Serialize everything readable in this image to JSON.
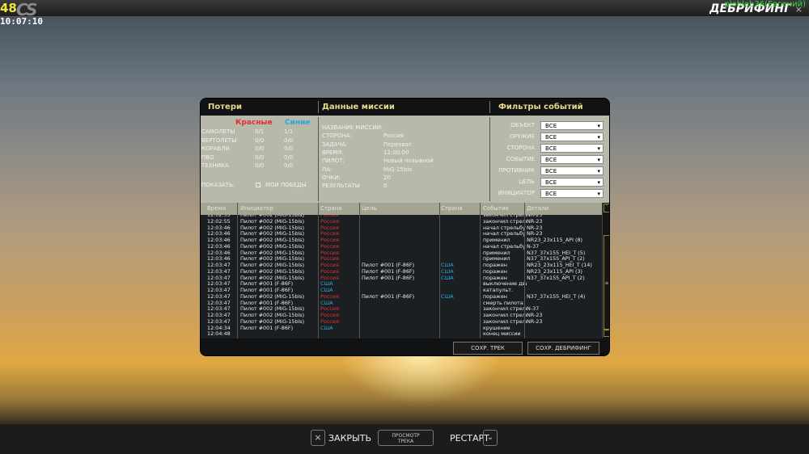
{
  "topbar": {
    "fps": "48",
    "logo": "CS",
    "clock": "10:07:10",
    "title": "ДЕБРИФИНГ",
    "user": "plohleb36(Евгений)",
    "close": "×"
  },
  "losses": {
    "title": "Потери",
    "red": "Красные",
    "blue": "Синие",
    "colors": {
      "red": "#e03030",
      "blue": "#2aa8e0"
    },
    "rows": [
      {
        "label": "САМОЛЕТЫ",
        "red": "0/1",
        "blue": "1/1"
      },
      {
        "label": "ВЕРТОЛЕТЫ",
        "red": "0/0",
        "blue": "0/0"
      },
      {
        "label": "КОРАБЛИ",
        "red": "0/0",
        "blue": "0/0"
      },
      {
        "label": "ПВО",
        "red": "0/0",
        "blue": "0/0"
      },
      {
        "label": "ТЕХНИКА",
        "red": "0/0",
        "blue": "0/0"
      }
    ],
    "show_label": "ПОКАЗАТЬ:",
    "my_wins": "МОИ ПОБЕДЫ",
    "my_wins_checked": false
  },
  "mission": {
    "title": "Данные миссии",
    "rows": [
      {
        "label": "НАЗВАНИЕ МИССИИ:",
        "value": ""
      },
      {
        "label": "СТОРОНА:",
        "value": "Россия"
      },
      {
        "label": "ЗАДАЧА:",
        "value": "Перехват"
      },
      {
        "label": "ВРЕМЯ:",
        "value": "12:00:00"
      },
      {
        "label": "ПИЛОТ:",
        "value": "Новый позывной"
      },
      {
        "label": "ЛА:",
        "value": "MiG-15bis"
      },
      {
        "label": "ОЧКИ:",
        "value": "20"
      },
      {
        "label": "РЕЗУЛЬТАТЫ",
        "value": "0"
      }
    ]
  },
  "filters": {
    "title": "Фильтры событий",
    "items": [
      {
        "label": "ОБЪЕКТ",
        "value": "ВСЕ"
      },
      {
        "label": "ОРУЖИЕ",
        "value": "ВСЕ"
      },
      {
        "label": "СТОРОНА",
        "value": "ВСЕ"
      },
      {
        "label": "СОБЫТИЕ",
        "value": "ВСЕ"
      },
      {
        "label": "ПРОТИВНИК",
        "value": "ВСЕ"
      },
      {
        "label": "ЦЕЛЬ",
        "value": "ВСЕ"
      },
      {
        "label": "ИНИЦИАТОР",
        "value": "ВСЕ"
      }
    ]
  },
  "table": {
    "columns": [
      "Время",
      "Инициатор",
      "Страна",
      "Цель",
      "Страна",
      "Событие",
      "Детали"
    ],
    "rows": [
      [
        "12:02:55",
        "Пилот #002 (MiG-15bis)",
        "Россия",
        "",
        "",
        "закончил стрельбу",
        "NR-23"
      ],
      [
        "12:02:55",
        "Пилот #002 (MiG-15bis)",
        "Россия",
        "",
        "",
        "закончил стрельбу",
        "NR-23"
      ],
      [
        "12:03:46",
        "Пилот #002 (MiG-15bis)",
        "Россия",
        "",
        "",
        "начал стрельбу",
        "NR-23"
      ],
      [
        "12:03:46",
        "Пилот #002 (MiG-15bis)",
        "Россия",
        "",
        "",
        "начал стрельбу",
        "NR-23"
      ],
      [
        "12:03:46",
        "Пилот #002 (MiG-15bis)",
        "Россия",
        "",
        "",
        "применил",
        "NR23_23x115_API (8)"
      ],
      [
        "12:03:46",
        "Пилот #002 (MiG-15bis)",
        "Россия",
        "",
        "",
        "начал стрельбу",
        "N-37"
      ],
      [
        "12:03:46",
        "Пилот #002 (MiG-15bis)",
        "Россия",
        "",
        "",
        "применил",
        "N37_37x155_HEI_T (5)"
      ],
      [
        "12:03:46",
        "Пилот #002 (MiG-15bis)",
        "Россия",
        "",
        "",
        "применил",
        "N37_37x155_API_T  (2)"
      ],
      [
        "12:03:47",
        "Пилот #002 (MiG-15bis)",
        "Россия",
        "Пилот #001 (F-86F)",
        "США",
        "поражен",
        "NR23_23x115_HEI_T (14)"
      ],
      [
        "12:03:47",
        "Пилот #002 (MiG-15bis)",
        "Россия",
        "Пилот #001 (F-86F)",
        "США",
        "поражен",
        "NR23_23x115_API (3)"
      ],
      [
        "12:03:47",
        "Пилот #002 (MiG-15bis)",
        "Россия",
        "Пилот #001 (F-86F)",
        "США",
        "поражен",
        "N37_37x155_API_T  (2)"
      ],
      [
        "12:03:47",
        "Пилот #001 (F-86F)",
        "США",
        "",
        "",
        "выключение двигателя",
        ""
      ],
      [
        "12:03:47",
        "Пилот #001 (F-86F)",
        "США",
        "",
        "",
        "катапульт.",
        ""
      ],
      [
        "12:03:47",
        "Пилот #002 (MiG-15bis)",
        "Россия",
        "Пилот #001 (F-86F)",
        "США",
        "поражен",
        "N37_37x155_HEI_T (4)"
      ],
      [
        "12:03:47",
        "Пилот #001 (F-86F)",
        "США",
        "",
        "",
        "смерть пилота",
        ""
      ],
      [
        "12:03:47",
        "Пилот #002 (MiG-15bis)",
        "Россия",
        "",
        "",
        "закончил стрельбу",
        "N-37"
      ],
      [
        "12:03:47",
        "Пилот #002 (MiG-15bis)",
        "Россия",
        "",
        "",
        "закончил стрельбу",
        "NR-23"
      ],
      [
        "12:03:47",
        "Пилот #002 (MiG-15bis)",
        "Россия",
        "",
        "",
        "закончил стрельбу",
        "NR-23"
      ],
      [
        "12:04:34",
        "Пилот #001 (F-86F)",
        "США",
        "",
        "",
        "крушение",
        ""
      ],
      [
        "12:04:48",
        "",
        "",
        "",
        "",
        "конец миссии",
        ""
      ]
    ]
  },
  "buttons": {
    "save_track": "СОХР. ТРЕК",
    "save_debrief": "СОХР. ДЕБРИФИНГ"
  },
  "bottom": {
    "close": "ЗАКРЫТЬ",
    "view_track": "ПРОСМОТР ТРЕКА",
    "restart": "РЕСТАРТ"
  }
}
